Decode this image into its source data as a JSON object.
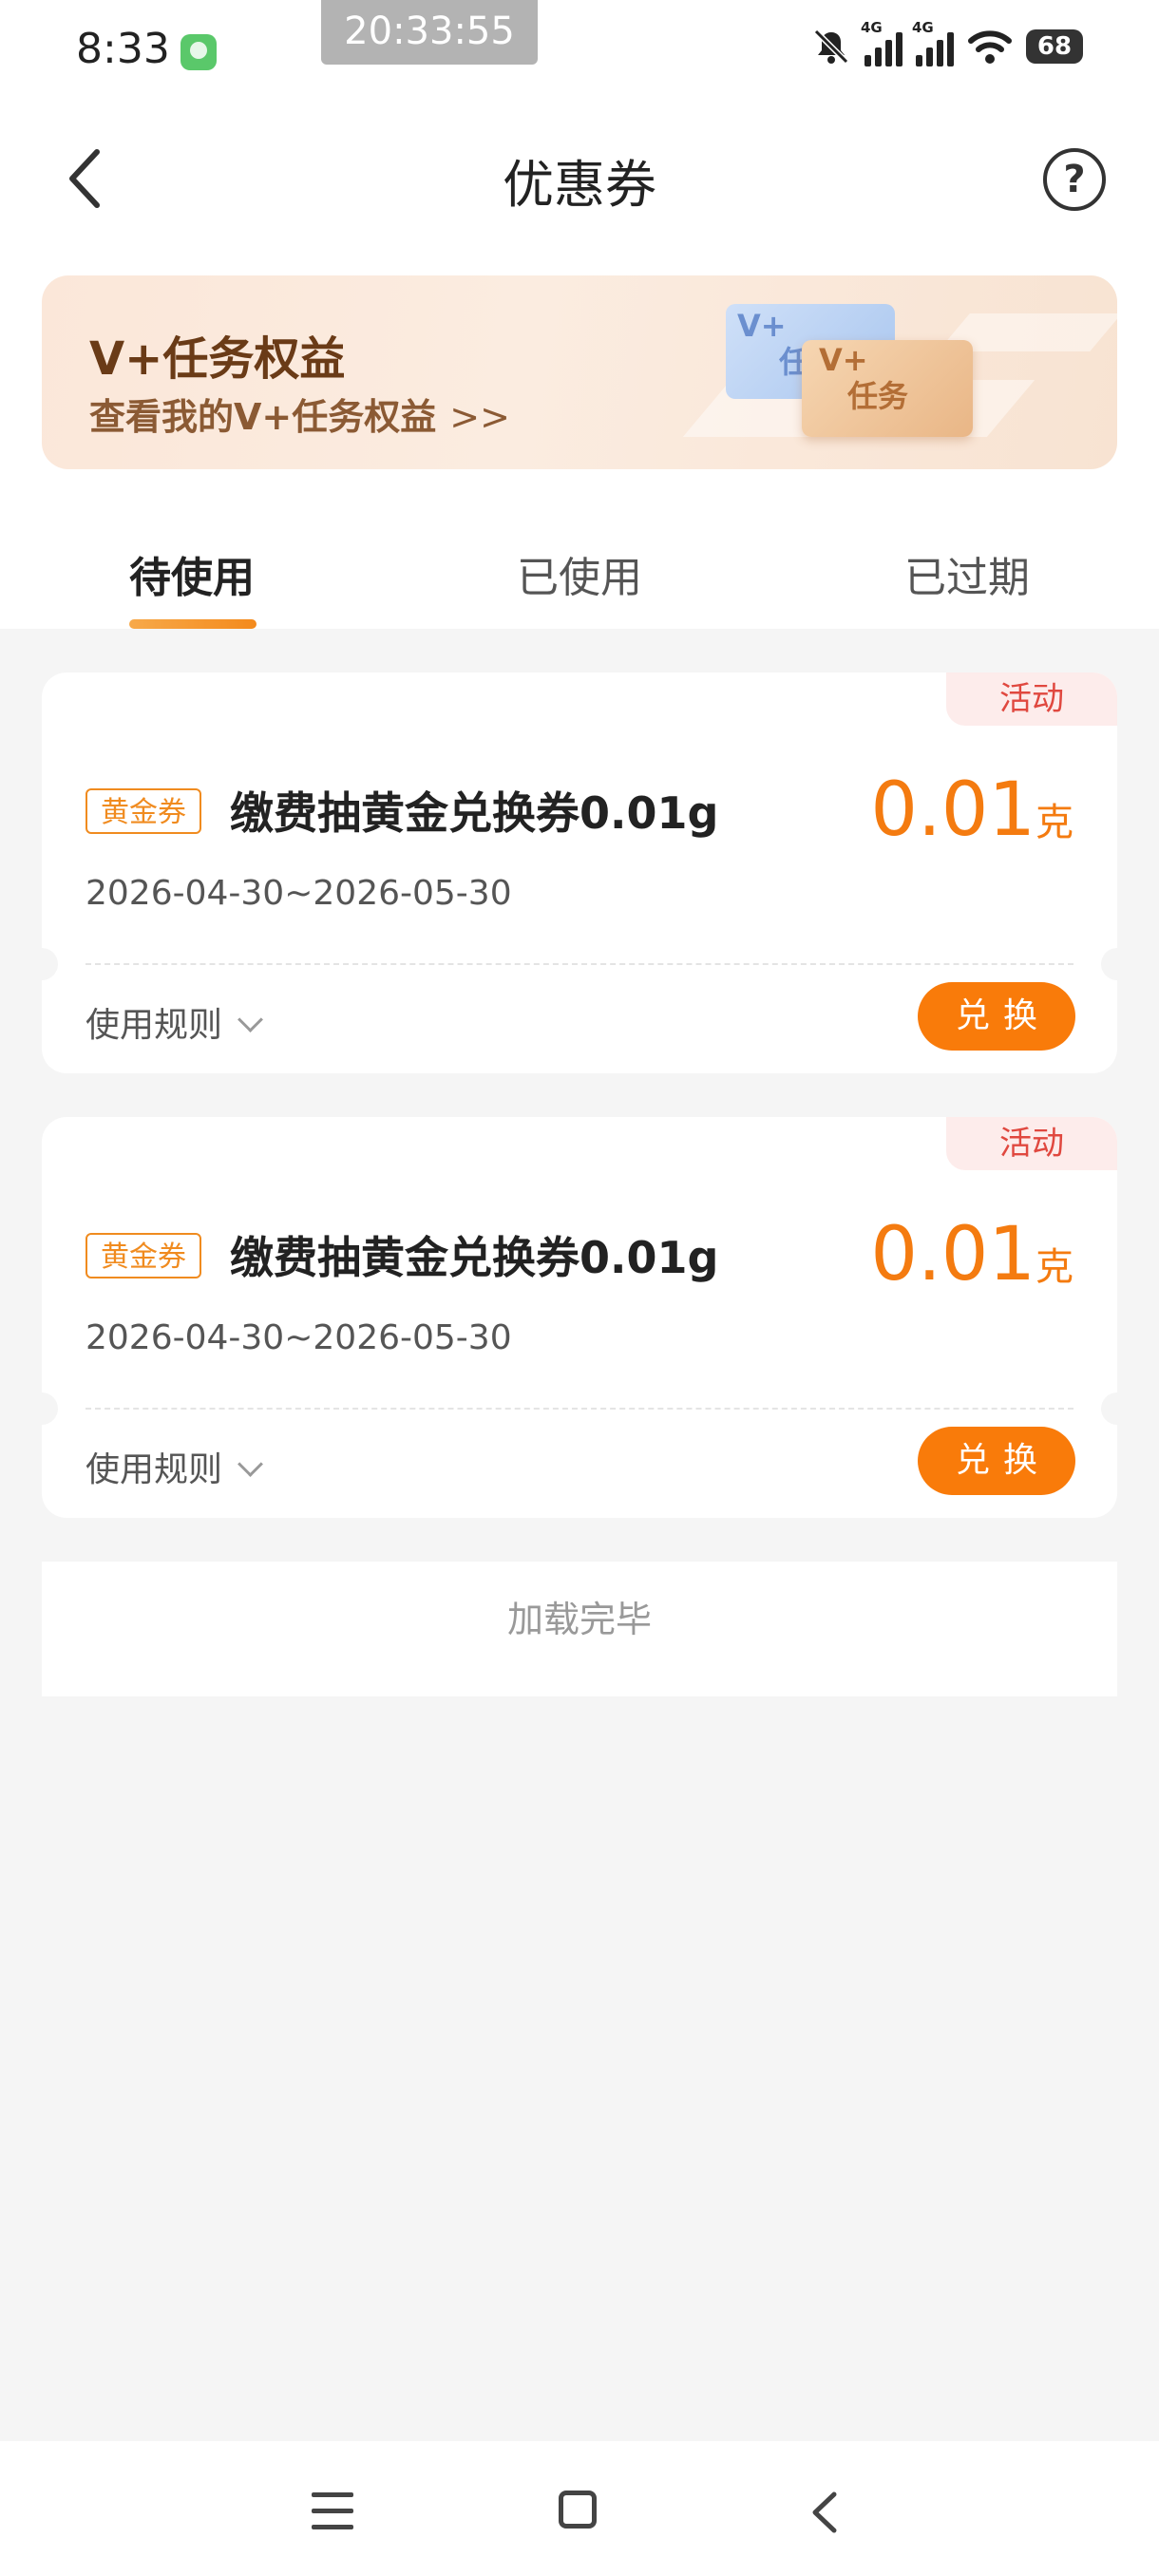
{
  "status_bar": {
    "time": "8:33",
    "clock_overlay": "20:33:55",
    "network": "4G",
    "battery": "68"
  },
  "header": {
    "title": "优惠券",
    "help_symbol": "?"
  },
  "banner": {
    "title": "V+任务权益",
    "subtitle": "查看我的V+任务权益",
    "arrow": ">>",
    "card_back_top": "V+",
    "card_back_bottom": "任",
    "card_front_top": "V+",
    "card_front_bottom": "任务"
  },
  "tabs": [
    {
      "label": "待使用",
      "active": true
    },
    {
      "label": "已使用",
      "active": false
    },
    {
      "label": "已过期",
      "active": false
    }
  ],
  "coupons": [
    {
      "ribbon": "活动",
      "tag": "黄金券",
      "name": "缴费抽黄金兑换券0.01g",
      "amount": "0.01",
      "unit": "克",
      "date_range": "2026-04-30~2026-05-30",
      "rules_label": "使用规则",
      "action_label": "兑换"
    },
    {
      "ribbon": "活动",
      "tag": "黄金券",
      "name": "缴费抽黄金兑换券0.01g",
      "amount": "0.01",
      "unit": "克",
      "date_range": "2026-04-30~2026-05-30",
      "rules_label": "使用规则",
      "action_label": "兑换"
    }
  ],
  "footer": {
    "text": "加载完毕"
  },
  "colors": {
    "accent": "#f97b0a",
    "ribbon_text": "#e0483f",
    "banner_title": "#6a3b17"
  }
}
